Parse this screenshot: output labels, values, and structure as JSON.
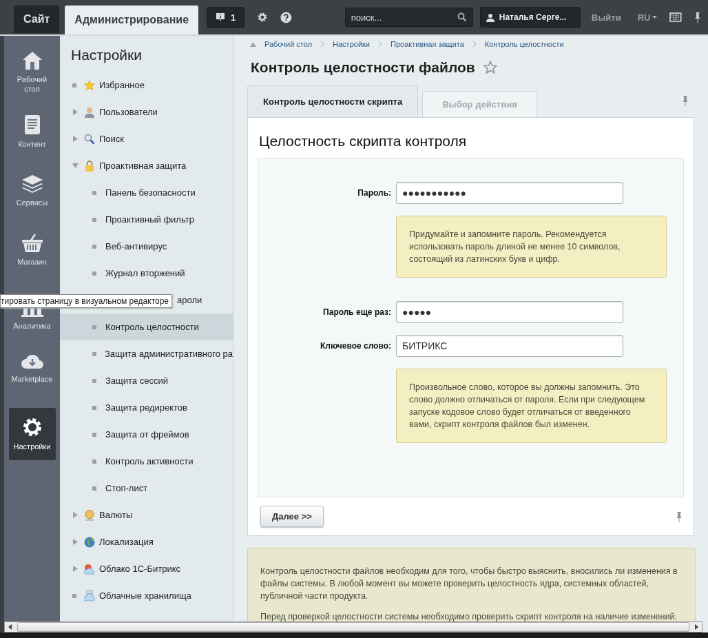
{
  "top_bar": {
    "tabs": [
      {
        "label": "Сайт",
        "selected": false
      },
      {
        "label": "Администрирование",
        "selected": true
      }
    ],
    "notifications": "1",
    "search": {
      "placeholder": "поиск..."
    },
    "user": "Наталья Серге...",
    "logout": "Выйти",
    "language": "RU"
  },
  "rail": [
    {
      "label": "Рабочий стол",
      "kind": "home",
      "selected": false
    },
    {
      "label": "Контент",
      "kind": "content",
      "selected": false
    },
    {
      "label": "Сервисы",
      "kind": "services",
      "selected": false
    },
    {
      "label": "Магазин",
      "kind": "shop",
      "selected": false
    },
    {
      "label": "Аналитика",
      "kind": "analytics",
      "selected": false
    },
    {
      "label": "Marketplace",
      "kind": "marketplace",
      "selected": false
    },
    {
      "label": "Настройки",
      "kind": "settings",
      "selected": true
    }
  ],
  "sidebar": {
    "title": "Настройки",
    "items": [
      {
        "label": "Избранное",
        "kind": "leaf",
        "selected": false
      },
      {
        "label": "Пользователи",
        "kind": "folder",
        "expanded": false,
        "selected": false
      },
      {
        "label": "Поиск",
        "kind": "folder",
        "expanded": false,
        "selected": false
      },
      {
        "label": "Проактивная защита",
        "kind": "folder",
        "expanded": true,
        "selected": false,
        "children": [
          {
            "label": "Панель безопасности",
            "selected": false
          },
          {
            "label": "Проактивный фильтр",
            "selected": false
          },
          {
            "label": "Веб-антивирус",
            "selected": false
          },
          {
            "label": "Журнал вторжений",
            "selected": false
          },
          {
            "label": "ароли",
            "selected": false,
            "covered": true
          },
          {
            "label": "Контроль целостности",
            "selected": true
          },
          {
            "label": "Защита административного ра",
            "selected": false
          },
          {
            "label": "Защита сессий",
            "selected": false
          },
          {
            "label": "Защита редиректов",
            "selected": false
          },
          {
            "label": "Защита от фреймов",
            "selected": false
          },
          {
            "label": "Контроль активности",
            "selected": false
          },
          {
            "label": "Стоп-лист",
            "selected": false
          }
        ]
      },
      {
        "label": "Валюты",
        "kind": "folder",
        "expanded": false,
        "selected": false
      },
      {
        "label": "Локализация",
        "kind": "folder",
        "expanded": false,
        "selected": false
      },
      {
        "label": "Облако 1С-Битрикс",
        "kind": "folder",
        "expanded": false,
        "selected": false
      },
      {
        "label": "Облачные хранилища",
        "kind": "leaf",
        "selected": false
      }
    ]
  },
  "tooltip": "тировать страницу в визуальном редакторе",
  "breadcrumbs": [
    "Рабочий стол",
    "Настройки",
    "Проактивная защита",
    "Контроль целостности"
  ],
  "page_title": "Контроль целостности файлов",
  "favorite": false,
  "tabs": [
    {
      "label": "Контроль целостности скрипта",
      "selected": true,
      "disabled": false
    },
    {
      "label": "Выбор действия",
      "selected": false,
      "disabled": true
    }
  ],
  "form": {
    "title": "Целостность скрипта контроля",
    "fields": [
      {
        "label": "Пароль:",
        "value": "●●●●●●●●●●●",
        "hint": "Придумайте и запомните пароль. Рекомендуется использовать пароль длиной не менее 10 символов, состоящий из латинских букв и цифр."
      },
      {
        "label": "Пароль еще раз:",
        "value": "●●●●●"
      },
      {
        "label": "Ключевое слово:",
        "value": "БИТРИКС",
        "hint": "Произвольное слово, которое вы должны запомнить. Это слово должно отличаться от пароля. Если при следующем запуске кодовое слово будет отличаться от введенного вами, скрипт контроля файлов был изменен."
      }
    ],
    "button": "Далее >>"
  },
  "note": [
    "Контроль целостности файлов необходим для того, чтобы быстро выяснить, вносились ли изменения в файлы системы. В любой момент вы можете проверить целостность ядра, системных областей, публичной части продукта.",
    "Перед проверкой целостности системы необходимо проверить скрипт контроля на наличие изменений."
  ]
}
